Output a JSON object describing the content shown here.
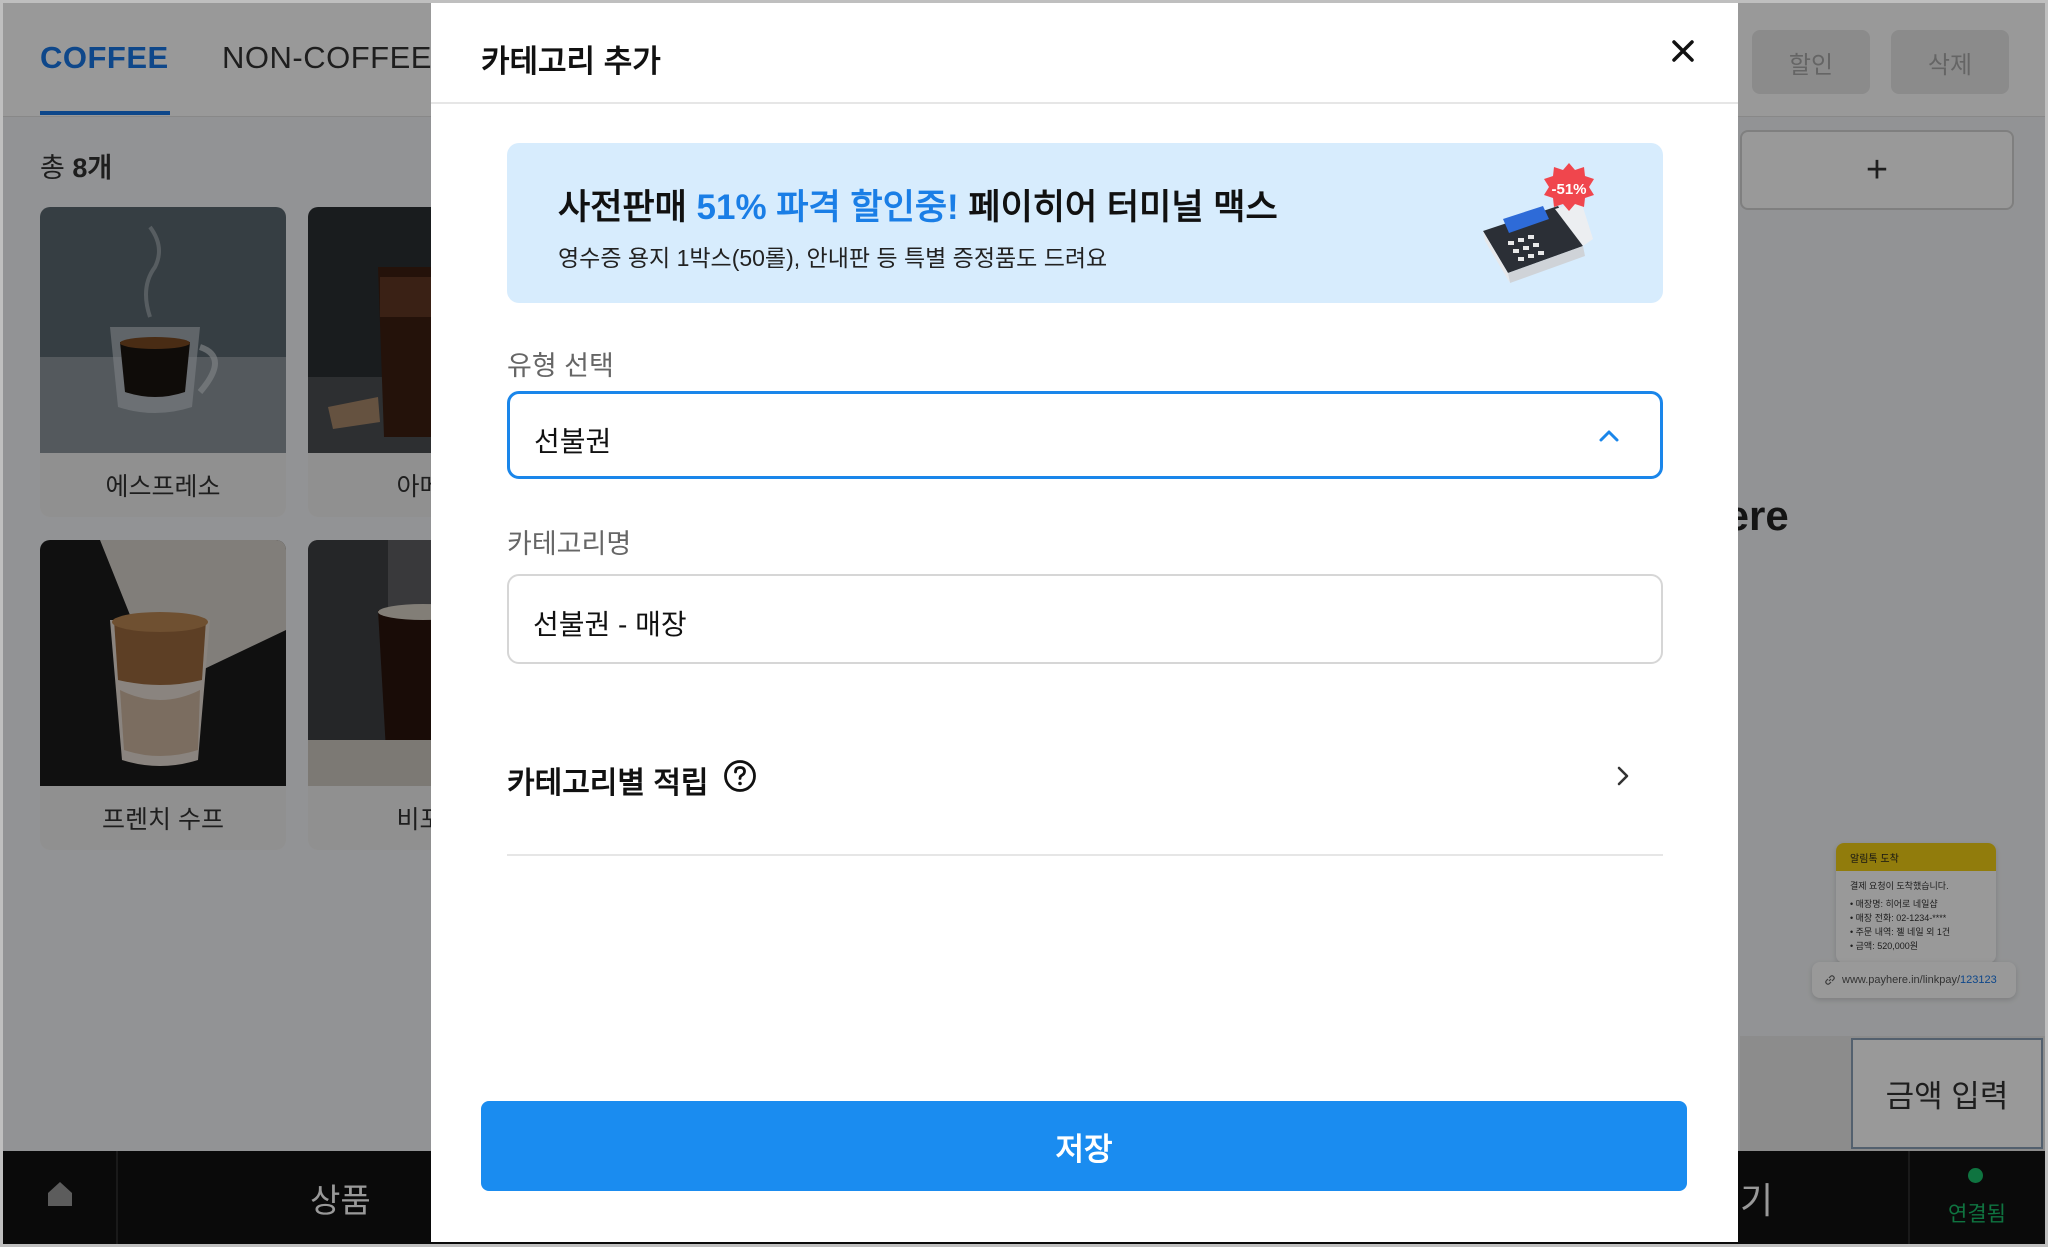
{
  "category_tabs": [
    {
      "label": "COFFEE",
      "active": true
    },
    {
      "label": "NON-COFFEE",
      "active": false
    }
  ],
  "toolbar": {
    "discount_label": "할인",
    "delete_label": "삭제",
    "add_label": "+"
  },
  "product_count": {
    "prefix": "총",
    "value": "8개"
  },
  "products": [
    {
      "name": "에스프레소"
    },
    {
      "name": "아메리"
    },
    {
      "name": "프렌치 수프"
    },
    {
      "name": "비포선"
    }
  ],
  "background_text": {
    "where_fragment": "here"
  },
  "notification": {
    "header": "알림톡 도착",
    "title": "결제 요청이 도착했습니다.",
    "lines": [
      "• 매장명: 히어로 네일샵",
      "• 매장 전화: 02-1234-****",
      "• 주문 내역: 젤 네일 외 1건",
      "• 금액: 520,000원"
    ],
    "link_prefix": "www.payhere.in/linkpay/",
    "link_number": "123123"
  },
  "amount_input_label": "금액 입력",
  "bottom_nav": {
    "products_label": "상품",
    "partial_label": "기",
    "connection_label": "연결됨"
  },
  "modal": {
    "title": "카테고리 추가",
    "banner": {
      "title_prefix": "사전판매 ",
      "title_highlight": "51% 파격 할인중!",
      "title_suffix": " 페이히어 터미널 맥스",
      "subtitle": "영수증 용지 1박스(50롤), 안내판 등 특별 증정품도 드려요",
      "badge": "-51%"
    },
    "type_label": "유형 선택",
    "type_value": "선불권",
    "name_label": "카테고리명",
    "name_value": "선불권 - 매장",
    "points_label": "카테고리별 적립",
    "save_label": "저장"
  },
  "colors": {
    "accent": "#1a8cf0",
    "tab_active": "#1877e6",
    "banner_bg": "#d7ecfd",
    "connected": "#19c26b"
  }
}
